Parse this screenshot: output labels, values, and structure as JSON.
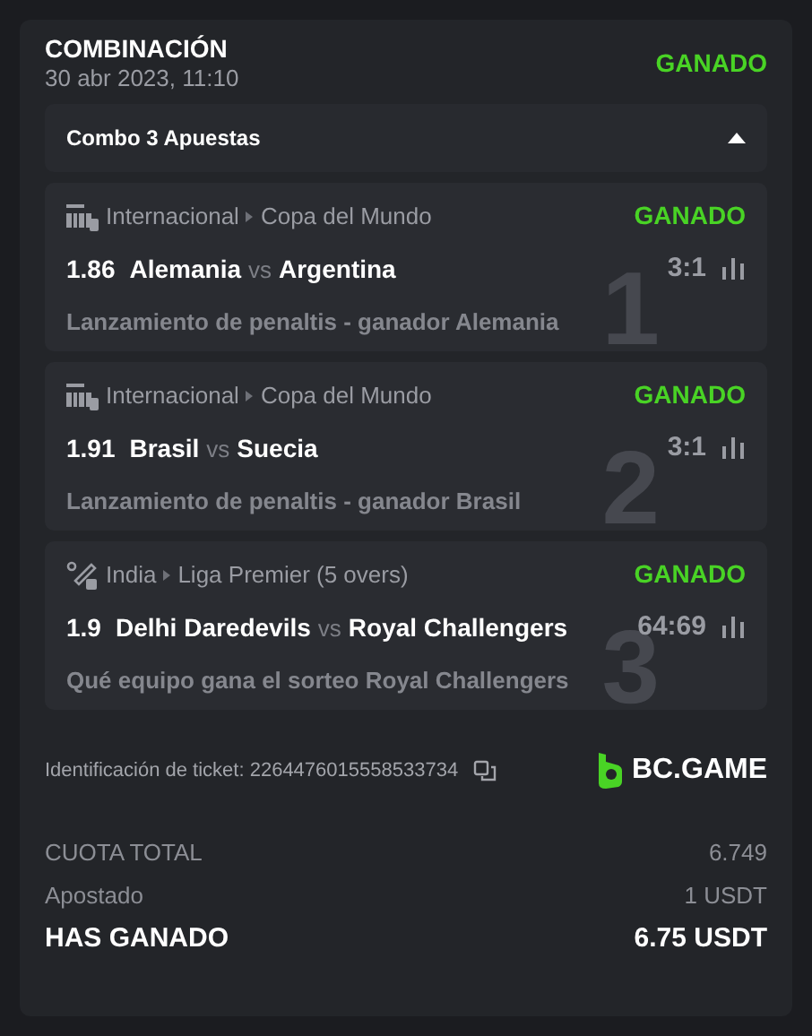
{
  "header": {
    "title": "COMBINACIÓN",
    "date": "30 abr 2023, 11:10",
    "status": "GANADO"
  },
  "combo": {
    "label": "Combo 3 Apuestas",
    "expanded": true
  },
  "bets": [
    {
      "index": "1",
      "kind": "fifa",
      "country": "Internacional",
      "league": "Copa del Mundo",
      "status": "GANADO",
      "odds": "1.86",
      "home": "Alemania",
      "vs": "vs",
      "away": "Argentina",
      "score": "3:1",
      "market": "Lanzamiento de penaltis - ganador Alemania"
    },
    {
      "index": "2",
      "kind": "fifa",
      "country": "Internacional",
      "league": "Copa del Mundo",
      "status": "GANADO",
      "odds": "1.91",
      "home": "Brasil",
      "vs": "vs",
      "away": "Suecia",
      "score": "3:1",
      "market": "Lanzamiento de penaltis - ganador Brasil"
    },
    {
      "index": "3",
      "kind": "cricket",
      "country": "India",
      "league": "Liga Premier (5 overs)",
      "status": "GANADO",
      "odds": "1.9",
      "home": "Delhi Daredevils",
      "vs": "vs",
      "away": "Royal Challengers",
      "score": "64:69",
      "market": "Qué equipo gana el sorteo Royal Challengers"
    }
  ],
  "ticket": {
    "label": "Identificación de ticket: 2264476015558533734"
  },
  "brand": "BC.GAME",
  "totals": [
    {
      "kind": "plain",
      "label": "CUOTA TOTAL",
      "value": "6.749"
    },
    {
      "kind": "plain",
      "label": "Apostado",
      "value": "1 USDT"
    },
    {
      "kind": "strong",
      "label": "HAS GANADO",
      "value": "6.75 USDT"
    }
  ]
}
